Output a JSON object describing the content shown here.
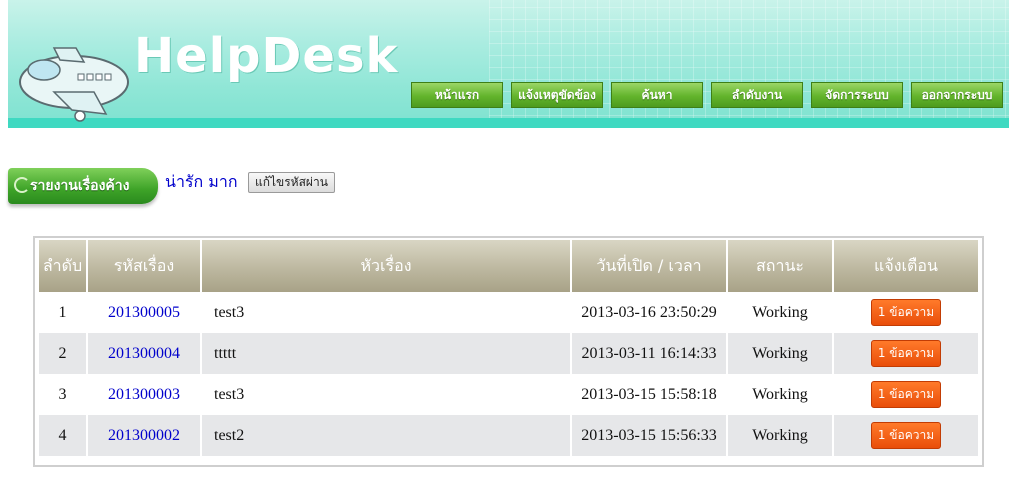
{
  "header": {
    "brand": "HelpDesk",
    "nav": [
      "หน้าแรก",
      "แจ้งเหตุขัดข้อง",
      "ค้นหา",
      "ลำดับงาน",
      "จัดการระบบ",
      "ออกจากระบบ"
    ]
  },
  "subbar": {
    "pending_label": "รายงานเรื่องค้าง",
    "username": "น่ารัก มาก",
    "change_password": "แก้ไขรหัสผ่าน"
  },
  "table": {
    "headers": [
      "ลำดับ",
      "รหัสเรื่อง",
      "หัวเรื่อง",
      "วันที่เปิด / เวลา",
      "สถานะ",
      "แจ้งเตือน"
    ],
    "rows": [
      {
        "num": "1",
        "code": "201300005",
        "title": "test3",
        "date": "2013-03-16 23:50:29",
        "status": "Working",
        "alert": "1 ข้อความ"
      },
      {
        "num": "2",
        "code": "201300004",
        "title": "ttttt",
        "date": "2013-03-11 16:14:33",
        "status": "Working",
        "alert": "1 ข้อความ"
      },
      {
        "num": "3",
        "code": "201300003",
        "title": "test3",
        "date": "2013-03-15 15:58:18",
        "status": "Working",
        "alert": "1 ข้อความ"
      },
      {
        "num": "4",
        "code": "201300002",
        "title": "test2",
        "date": "2013-03-15 15:56:33",
        "status": "Working",
        "alert": "1 ข้อความ"
      }
    ]
  },
  "colors": {
    "accent": "#3fd9c1",
    "nav_green": "#63b42c",
    "alert_orange": "#e94e0a",
    "link_blue": "#0000cc"
  }
}
